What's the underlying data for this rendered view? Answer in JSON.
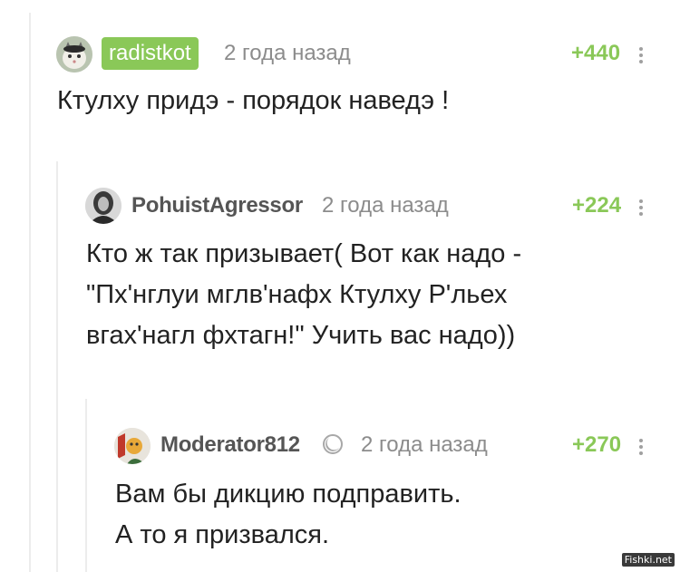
{
  "comments": [
    {
      "author": "radistkot",
      "avatar_icon": "cat-avatar-icon",
      "time": "2 года назад",
      "rating": "+440",
      "text_lines": [
        "Ктулху придэ - порядок наведэ !"
      ]
    },
    {
      "author": "PohuistAgressor",
      "avatar_icon": "person-avatar-icon",
      "time": "2 года назад",
      "rating": "+224",
      "text_lines": [
        "Кто ж так призывает( Вот как надо -",
        "\"Пх'нглуи мглв'нафх Ктулху Р'льех",
        "вгах'нагл фхтагн!\" Учить вас надо))"
      ]
    },
    {
      "author": "Moderator812",
      "avatar_icon": "moderator-avatar-icon",
      "badge_icon": "moon-icon",
      "time": "2 года назад",
      "rating": "+270",
      "text_lines": [
        "Вам бы дикцию подправить.",
        "А то я призвался."
      ]
    }
  ],
  "watermark": "Fishki.net",
  "colors": {
    "accent_green": "#8ac858",
    "thread_line": "#ececec",
    "muted_text": "#8c8c8c"
  }
}
